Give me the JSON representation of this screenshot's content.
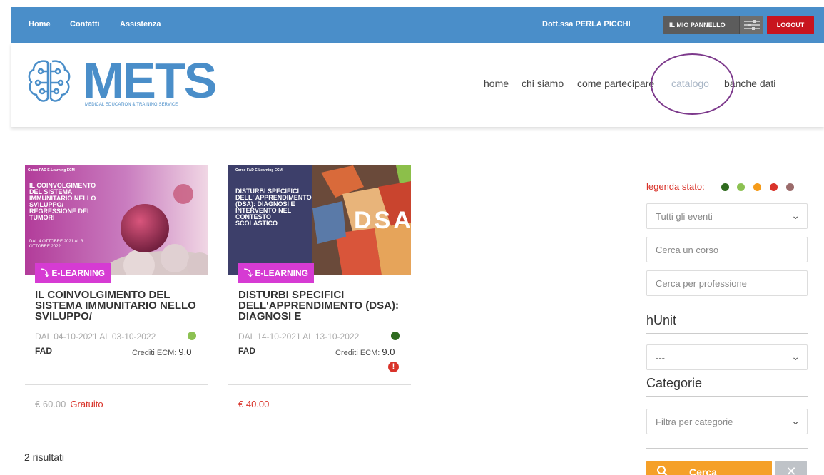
{
  "topbar": {
    "links": [
      "Home",
      "Contatti",
      "Assistenza"
    ],
    "user_name": "Dott.ssa PERLA PICCHI",
    "panel_label": "IL MIO PANNELLO",
    "logout_label": "LOGOUT"
  },
  "header": {
    "logo_text": "METS",
    "logo_tagline": "MEDICAL EDUCATION & TRAINING SERVICE",
    "nav": [
      "home",
      "chi siamo",
      "come partecipare",
      "catalogo",
      "banche dati"
    ],
    "active_nav": "catalogo"
  },
  "courses": [
    {
      "badge": "E-LEARNING",
      "title": "IL COINVOLGIMENTO DEL SISTEMA IMMUNITARIO NELLO SVILUPPO/",
      "dates": "DAL 04-10-2021 AL 03-10-2022",
      "status_color": "#8cc152",
      "mode": "FAD",
      "credits_label": "Crediti ECM:",
      "credits_value": "9.0",
      "old_price": "€ 60.00",
      "price": "Gratuito",
      "thumb_label": "Corso FAD E-Learning ECM",
      "thumb_title": "IL COINVOLGIMENTO DEL SISTEMA IMMUNITARIO NELLO SVILUPPO/ REGRESSIONE DEI TUMORI",
      "thumb_dates": "DAL 4 OTTOBRE 2021 AL 3 OTTOBRE 2022"
    },
    {
      "badge": "E-LEARNING",
      "title": "DISTURBI SPECIFICI DELL'APPRENDIMENTO (DSA): DIAGNOSI E",
      "dates": "DAL 14-10-2021 AL 13-10-2022",
      "status_color": "#2f6b1f",
      "mode": "FAD",
      "credits_label": "Crediti ECM:",
      "credits_value": "9.0",
      "price": "€ 40.00",
      "thumb_label": "Corso FAD E-Learning ECM",
      "thumb_title": "DISTURBI SPECIFICI DELL' APPRENDIMENTO (DSA): DIAGNOSI E INTERVENTO NEL CONTESTO SCOLASTICO",
      "thumb_blocks": "DSA"
    }
  ],
  "results_text": "2 risultati",
  "sidebar": {
    "legend_label": "legenda stato:",
    "legend_colors": [
      "#2f6b1f",
      "#8cc152",
      "#f59b1a",
      "#d9332a",
      "#9b6b6b"
    ],
    "events_select": "Tutti gli eventi",
    "search_course_placeholder": "Cerca un corso",
    "search_profession_placeholder": "Cerca per professione",
    "hunit_title": "hUnit",
    "hunit_select": "---",
    "categories_title": "Categorie",
    "categories_select": "Filtra per categorie",
    "search_button": "Cerca"
  }
}
